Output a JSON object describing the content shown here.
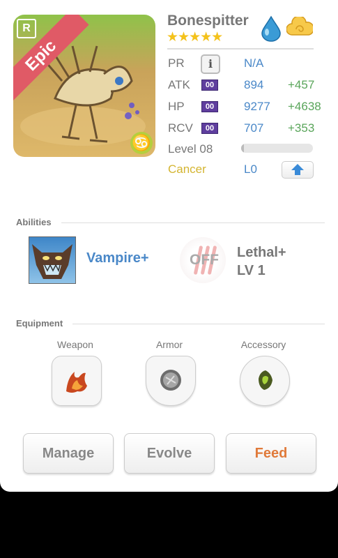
{
  "monster": {
    "rarity": "Epic",
    "box_badge": "R",
    "name": "Bonespitter",
    "stars": "★★★★★",
    "stars_count": 5,
    "element_icon": "water-drop-icon",
    "type_icon": "cloud-icon",
    "sign_glyph": "♋"
  },
  "stats": {
    "pr": {
      "label": "PR",
      "value": "N/A",
      "info": "i"
    },
    "atk": {
      "label": "ATK",
      "badge": "00",
      "value": "894",
      "bonus": "+457"
    },
    "hp": {
      "label": "HP",
      "badge": "00",
      "value": "9277",
      "bonus": "+4638"
    },
    "rcv": {
      "label": "RCV",
      "badge": "00",
      "value": "707",
      "bonus": "+353"
    },
    "level": {
      "label": "Level 08",
      "exp_progress": 0.04
    },
    "sign": {
      "label": "Cancer",
      "skill_level": "L0"
    }
  },
  "abilities": {
    "title": "Abilities",
    "active": {
      "name": "Vampire+"
    },
    "passive": {
      "status": "OFF",
      "name_line1": "Lethal+",
      "name_line2": "LV 1"
    }
  },
  "equipment": {
    "title": "Equipment",
    "slots": [
      {
        "label": "Weapon",
        "icon": "flame-claw-icon"
      },
      {
        "label": "Armor",
        "icon": "silver-orb-icon"
      },
      {
        "label": "Accessory",
        "icon": "green-gem-icon"
      }
    ]
  },
  "actions": {
    "manage": "Manage",
    "evolve": "Evolve",
    "feed": "Feed"
  },
  "colors": {
    "name_gray": "#777777",
    "stat_blue": "#4a88c8",
    "bonus_green": "#59a55a",
    "cancer_gold": "#d4b531",
    "feed_orange": "#e07a3a",
    "epic_ribbon": "#e05a66",
    "badge_purple": "#5f3e9e"
  }
}
